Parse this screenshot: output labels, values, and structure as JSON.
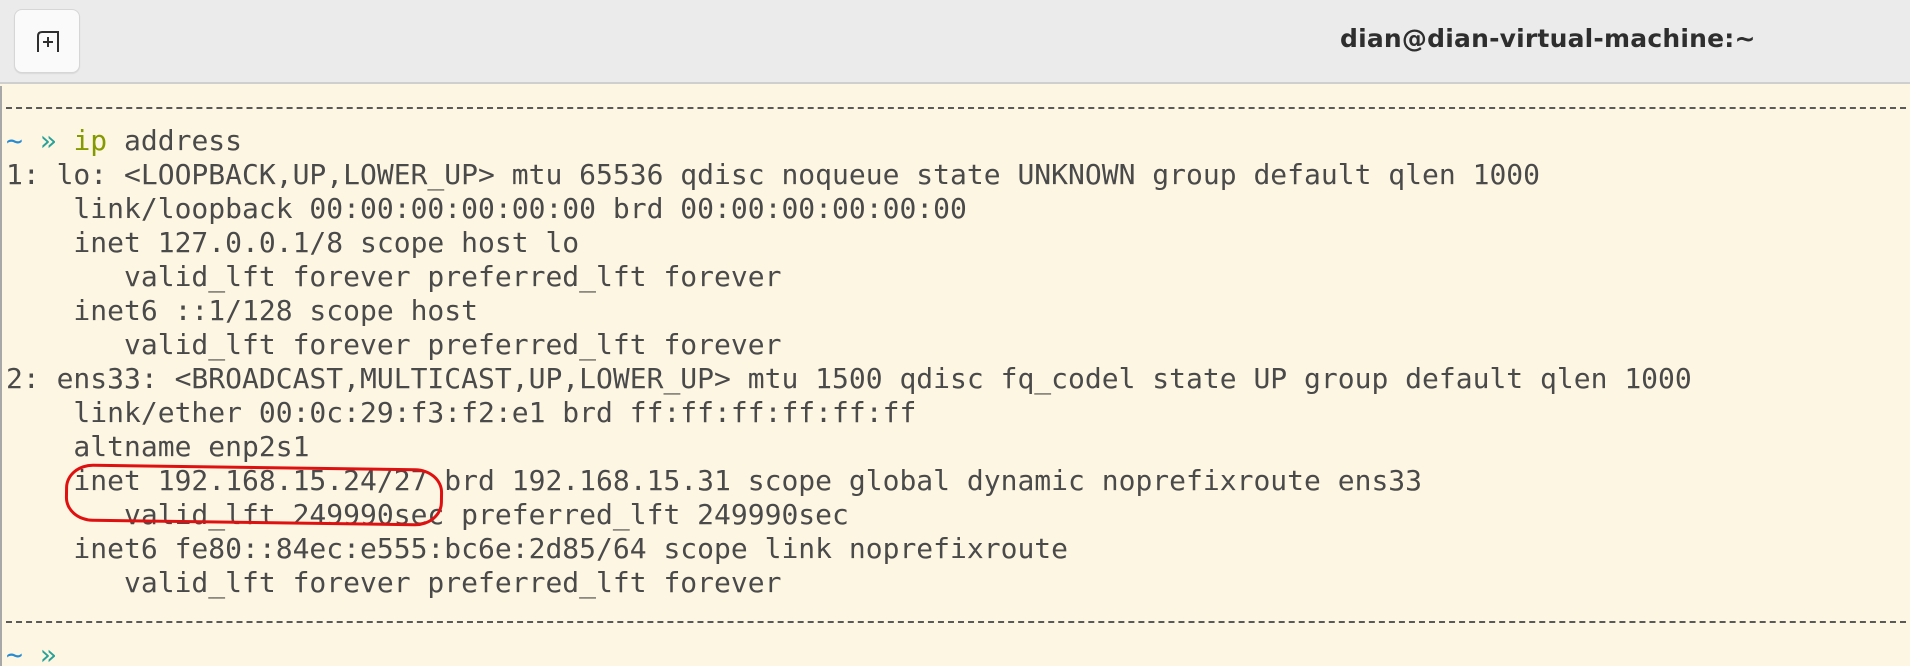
{
  "window": {
    "title": "dian@dian-virtual-machine:~"
  },
  "toolbar": {
    "new_tab_icon": "new-tab-icon"
  },
  "colors": {
    "terminal_bg": "#fdf6e3",
    "prompt_tilde": "#268bd2",
    "prompt_arrow": "#2aa198",
    "command": "#859900",
    "annotation": "#e01010"
  },
  "terminal": {
    "prompt_1": {
      "tilde": "~",
      "arrow": "»",
      "command": "ip",
      "args": " address"
    },
    "output": [
      "1: lo: <LOOPBACK,UP,LOWER_UP> mtu 65536 qdisc noqueue state UNKNOWN group default qlen 1000",
      "    link/loopback 00:00:00:00:00:00 brd 00:00:00:00:00:00",
      "    inet 127.0.0.1/8 scope host lo",
      "       valid_lft forever preferred_lft forever",
      "    inet6 ::1/128 scope host",
      "       valid_lft forever preferred_lft forever",
      "2: ens33: <BROADCAST,MULTICAST,UP,LOWER_UP> mtu 1500 qdisc fq_codel state UP group default qlen 1000",
      "    link/ether 00:0c:29:f3:f2:e1 brd ff:ff:ff:ff:ff:ff",
      "    altname enp2s1",
      "    inet 192.168.15.24/27 brd 192.168.15.31 scope global dynamic noprefixroute ens33",
      "       valid_lft 249990sec preferred_lft 249990sec",
      "    inet6 fe80::84ec:e555:bc6e:2d85/64 scope link noprefixroute",
      "       valid_lft forever preferred_lft forever"
    ],
    "prompt_2": {
      "tilde": "~",
      "arrow": "»"
    }
  }
}
